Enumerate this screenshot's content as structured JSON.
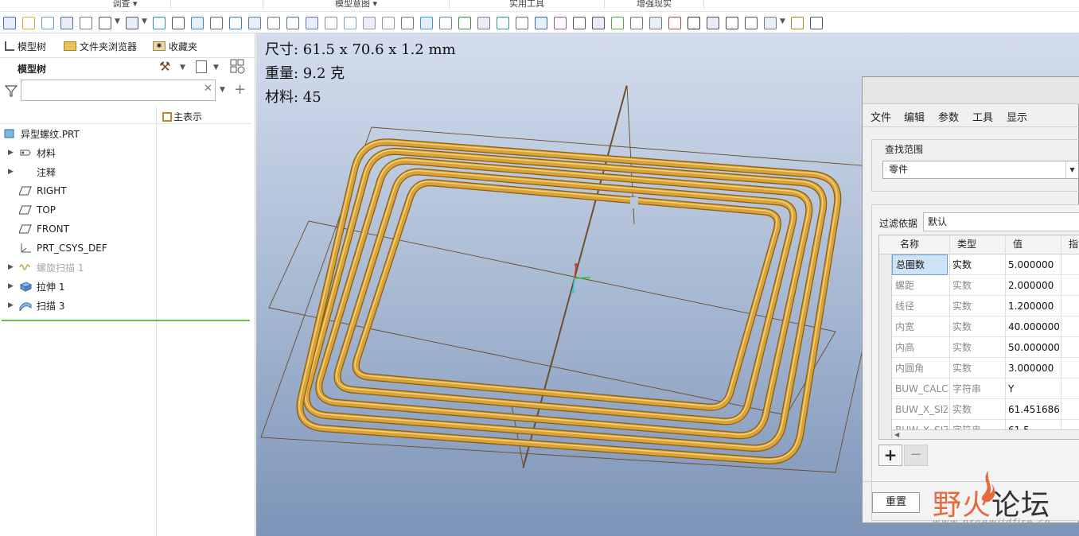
{
  "ribbon_groups": [
    "调查",
    "模型意图",
    "实用工具",
    "增强现实"
  ],
  "left_panel": {
    "tabs": [
      "模型树",
      "文件夹浏览器",
      "收藏夹"
    ],
    "header": "模型树",
    "search_placeholder": "",
    "column_header": "主表示",
    "tree": [
      {
        "label": "异型螺纹.PRT",
        "icon": "part-icon",
        "arrow": ""
      },
      {
        "label": "材料",
        "icon": "material-icon",
        "arrow": "▶"
      },
      {
        "label": "注释",
        "icon": "",
        "arrow": "▶"
      },
      {
        "label": "RIGHT",
        "icon": "datum-plane-icon",
        "arrow": ""
      },
      {
        "label": "TOP",
        "icon": "datum-plane-icon",
        "arrow": ""
      },
      {
        "label": "FRONT",
        "icon": "datum-plane-icon",
        "arrow": ""
      },
      {
        "label": "PRT_CSYS_DEF",
        "icon": "csys-icon",
        "arrow": ""
      },
      {
        "label": "螺旋扫描 1",
        "icon": "helical-sweep-icon",
        "arrow": "▶",
        "dimmed": true
      },
      {
        "label": "拉伸 1",
        "icon": "extrude-icon",
        "arrow": "▶"
      },
      {
        "label": "扫描 3",
        "icon": "sweep-icon",
        "arrow": "▶"
      }
    ]
  },
  "viewport": {
    "info_lines": [
      "尺寸: 61.5 x 70.6 x 1.2 mm",
      "重量: 9.2 克",
      "材料: 45"
    ]
  },
  "dialog": {
    "menu": [
      "文件",
      "编辑",
      "参数",
      "工具",
      "显示"
    ],
    "scope_label": "查找范围",
    "scope_value": "零件",
    "filter_label": "过滤依据",
    "filter_value": "默认",
    "columns": [
      "名称",
      "类型",
      "值",
      "指"
    ],
    "rows": [
      {
        "name": "总圈数",
        "type": "实数",
        "value": "5.000000"
      },
      {
        "name": "螺距",
        "type": "实数",
        "value": "2.000000"
      },
      {
        "name": "线径",
        "type": "实数",
        "value": "1.200000"
      },
      {
        "name": "内宽",
        "type": "实数",
        "value": "40.000000"
      },
      {
        "name": "内高",
        "type": "实数",
        "value": "50.000000"
      },
      {
        "name": "内圆角",
        "type": "实数",
        "value": "3.000000"
      },
      {
        "name": "BUW_CALC",
        "type": "字符串",
        "value": "Y"
      },
      {
        "name": "BUW_X_SIZ",
        "type": "实数",
        "value": "61.451686"
      },
      {
        "name": "BUW_X_SIZ",
        "type": "字符串",
        "value": "61.5"
      }
    ],
    "reset_label": "重置"
  },
  "watermark": {
    "text": "野火论坛",
    "url": "www.proewildfire.cn"
  },
  "colors": {
    "pipe": "#d9a33a",
    "pipe_edge": "#8a5d10",
    "accent_green": "#3fbf3f"
  }
}
